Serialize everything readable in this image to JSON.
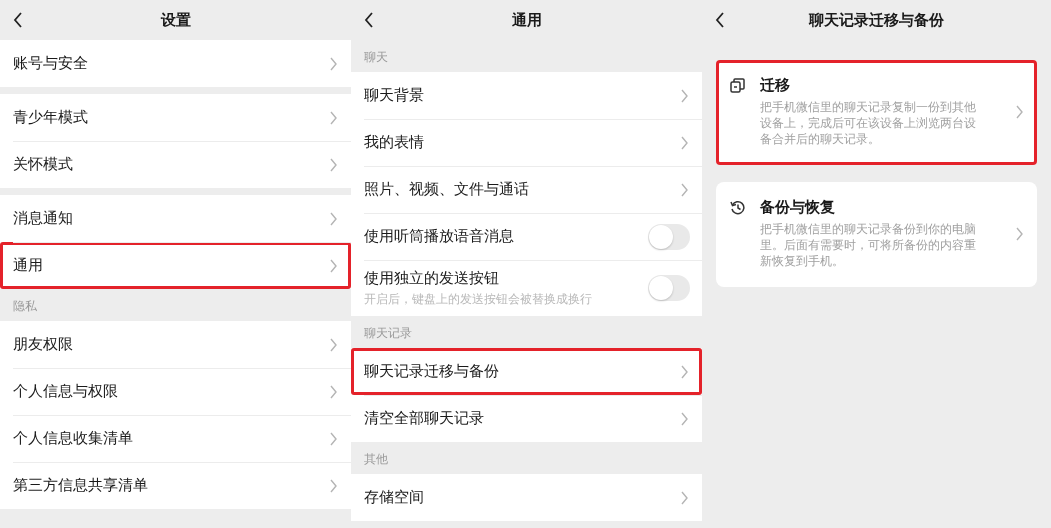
{
  "panels": [
    {
      "title": "设置",
      "groups": [
        {
          "items": [
            {
              "label": "账号与安全",
              "kind": "link",
              "highlighted": false
            }
          ]
        },
        {
          "items": [
            {
              "label": "青少年模式",
              "kind": "link",
              "highlighted": false
            },
            {
              "label": "关怀模式",
              "kind": "link",
              "highlighted": false
            }
          ]
        },
        {
          "items": [
            {
              "label": "消息通知",
              "kind": "link",
              "highlighted": false
            },
            {
              "label": "通用",
              "kind": "link",
              "highlighted": true
            }
          ]
        },
        {
          "label": "隐私",
          "items": [
            {
              "label": "朋友权限",
              "kind": "link",
              "highlighted": false
            },
            {
              "label": "个人信息与权限",
              "kind": "link",
              "highlighted": false
            },
            {
              "label": "个人信息收集清单",
              "kind": "link",
              "highlighted": false
            },
            {
              "label": "第三方信息共享清单",
              "kind": "link",
              "highlighted": false
            }
          ]
        }
      ]
    },
    {
      "title": "通用",
      "groups": [
        {
          "label": "聊天",
          "items": [
            {
              "label": "聊天背景",
              "kind": "link",
              "highlighted": false
            },
            {
              "label": "我的表情",
              "kind": "link",
              "highlighted": false
            },
            {
              "label": "照片、视频、文件与通话",
              "kind": "link",
              "highlighted": false
            },
            {
              "label": "使用听筒播放语音消息",
              "kind": "toggle",
              "on": false,
              "highlighted": false
            },
            {
              "label": "使用独立的发送按钮",
              "subtitle": "开启后，键盘上的发送按钮会被替换成换行",
              "kind": "toggle",
              "on": false,
              "highlighted": false
            }
          ]
        },
        {
          "label": "聊天记录",
          "items": [
            {
              "label": "聊天记录迁移与备份",
              "kind": "link",
              "highlighted": true
            },
            {
              "label": "清空全部聊天记录",
              "kind": "link",
              "highlighted": false
            }
          ]
        },
        {
          "label": "其他",
          "items": [
            {
              "label": "存储空间",
              "kind": "link",
              "highlighted": false
            }
          ]
        }
      ]
    },
    {
      "title": "聊天记录迁移与备份",
      "cards": [
        {
          "kind": "migrate",
          "title": "迁移",
          "description": "把手机微信里的聊天记录复制一份到其他设备上，完成后可在该设备上浏览两台设备合并后的聊天记录。",
          "highlighted": true
        },
        {
          "kind": "backup",
          "title": "备份与恢复",
          "description": "把手机微信里的聊天记录备份到你的电脑里。后面有需要时，可将所备份的内容重新恢复到手机。",
          "highlighted": false
        }
      ]
    }
  ]
}
